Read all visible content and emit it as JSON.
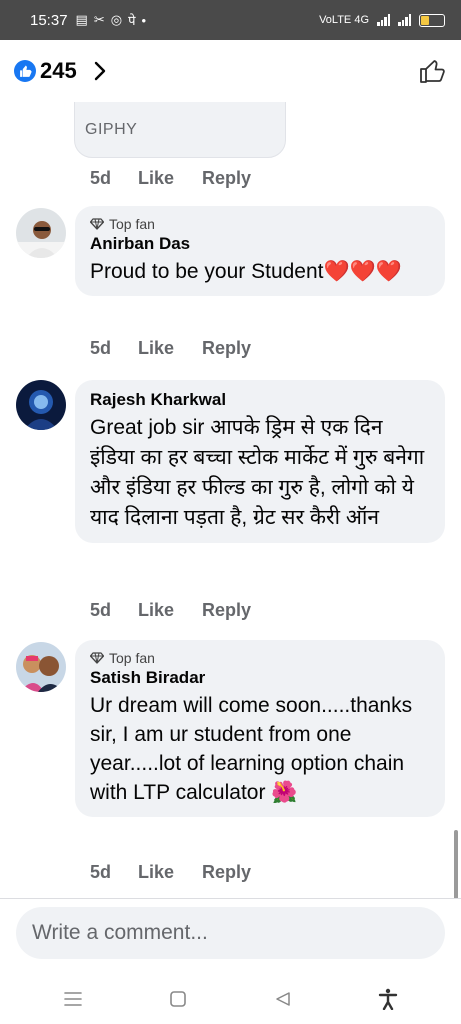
{
  "status_bar": {
    "time": "15:37",
    "app_icons": [
      "▤",
      "✂",
      "◎",
      "पे",
      "•"
    ],
    "network": "VoLTE 4G",
    "battery_level": 0.35,
    "battery_color": "#f5c842"
  },
  "header": {
    "like_count": "245",
    "accent": "#1877f2"
  },
  "giphy": {
    "label": "GIPHY"
  },
  "action_labels": {
    "time": "5d",
    "like": "Like",
    "reply": "Reply"
  },
  "comments": [
    {
      "author": "Anirban Das",
      "badge": "Top fan",
      "text": "Proud to be your Student❤️❤️❤️"
    },
    {
      "author": "Rajesh Kharkwal",
      "badge": "",
      "text": "Great job sir आपके ड्रिम से एक दिन इंडिया  का हर बच्चा स्टोक मार्केट में गुरु बनेगा और इंडिया हर फील्ड का गुरु है, लोगो को ये याद दिलाना पड़ता है, ग्रेट सर कैरी ऑन"
    },
    {
      "author": "Satish Biradar",
      "badge": "Top fan",
      "text": "Ur dream will come soon.....thanks sir, I am ur student from one year.....lot of learning option chain with LTP calculator  🌺"
    }
  ],
  "composer": {
    "placeholder": "Write a comment..."
  },
  "nav": {
    "icons": [
      "menu-icon",
      "home-icon",
      "back-icon",
      "accessibility-icon"
    ]
  }
}
